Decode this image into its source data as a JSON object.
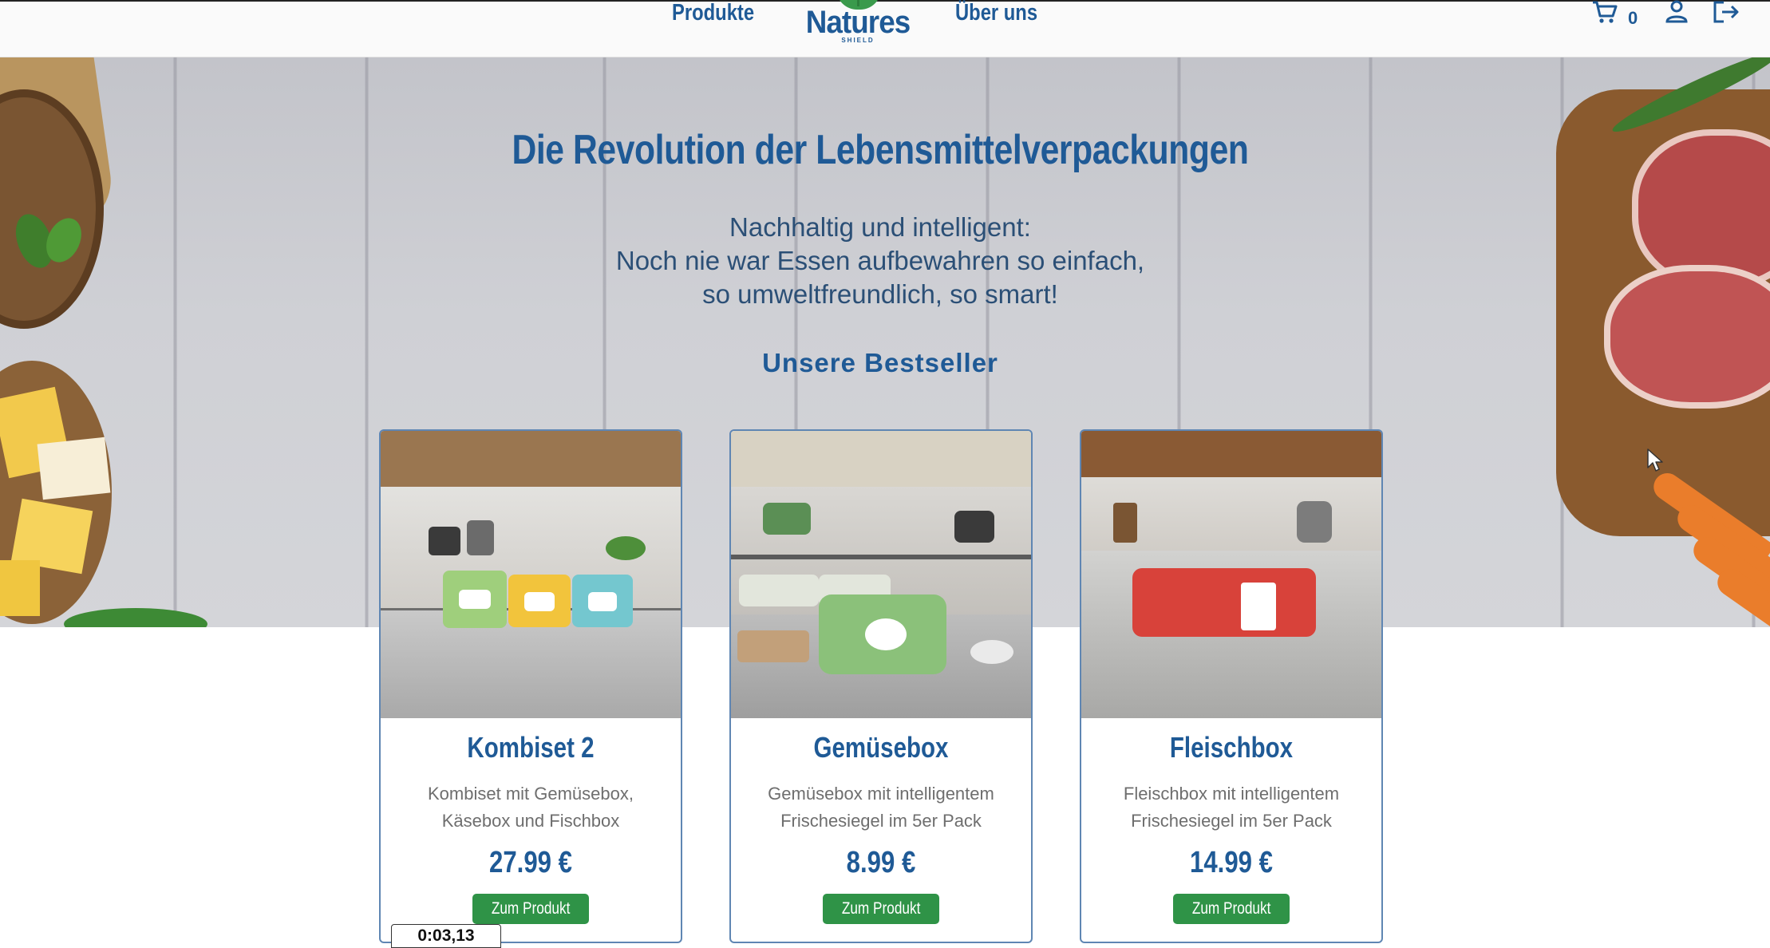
{
  "header": {
    "nav_products": "Produkte",
    "nav_about": "Über uns",
    "logo_text": "Natures",
    "logo_subtext": "SHIELD",
    "cart_count": "0",
    "icons": [
      "cart-icon",
      "user-icon",
      "logout-icon"
    ]
  },
  "hero": {
    "title": "Die Revolution der Lebensmittelverpackungen",
    "subtitle_line1": "Nachhaltig und intelligent:",
    "subtitle_line2": "Noch nie war Essen aufbewahren so einfach,",
    "subtitle_line3": "so umweltfreundlich, so smart!",
    "bestseller_heading": "Unsere Bestseller"
  },
  "products": [
    {
      "name": "Kombiset 2",
      "desc_line1": "Kombiset mit Gemüsebox,",
      "desc_line2": "Käsebox und Fischbox",
      "price": "27.99 €",
      "button": "Zum Produkt"
    },
    {
      "name": "Gemüsebox",
      "desc_line1": "Gemüsebox mit intelligentem",
      "desc_line2": "Frischesiegel im 5er Pack",
      "price": "8.99 €",
      "button": "Zum Produkt"
    },
    {
      "name": "Fleischbox",
      "desc_line1": "Fleischbox mit intelligentem",
      "desc_line2": "Frischesiegel im 5er Pack",
      "price": "14.99 €",
      "button": "Zum Produkt"
    }
  ],
  "overlay": {
    "timer": "0:03,13"
  },
  "colors": {
    "brand_blue": "#1f5a96",
    "button_green": "#2f9347",
    "text_gray": "#6e6e6e"
  }
}
